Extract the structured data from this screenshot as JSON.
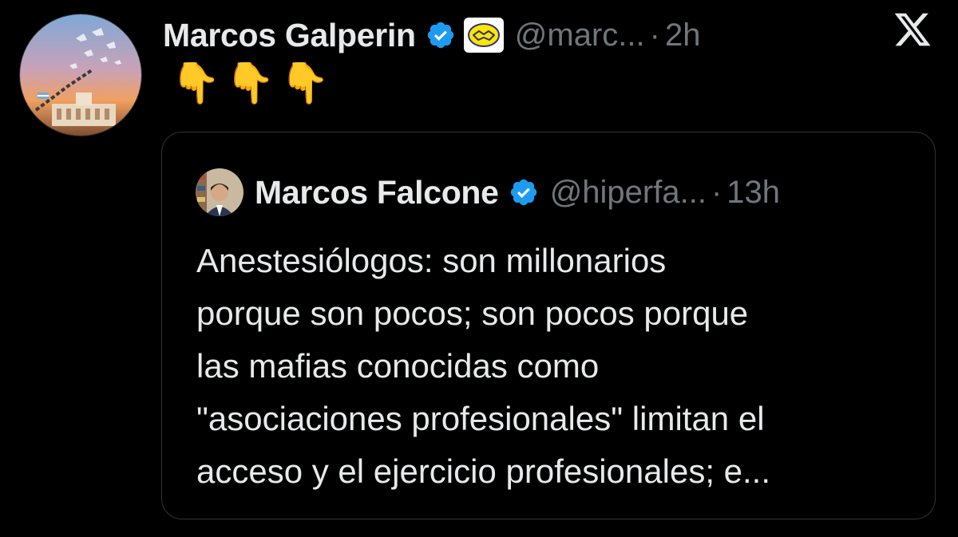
{
  "tweet": {
    "author": {
      "display_name": "Marcos Galperin",
      "handle": "@marc...",
      "time": "2h",
      "separator": "·",
      "verified_icon": "verified-badge-icon",
      "affiliate_icon": "handshake-affiliate-icon"
    },
    "text": "👇👇👇"
  },
  "quoted_tweet": {
    "author": {
      "display_name": "Marcos Falcone",
      "handle": "@hiperfa...",
      "time": "13h",
      "separator": "·",
      "verified_icon": "verified-badge-icon"
    },
    "text": "Anestesiólogos: son millonarios\nporque son pocos; son pocos porque\nlas mafias conocidas como\n\"asociaciones profesionales\" limitan el\nacceso y el ejercicio profesionales; e..."
  },
  "branding": {
    "logo_icon": "x-logo-icon"
  },
  "colors": {
    "background": "#000000",
    "text_primary": "#e7e9ea",
    "text_secondary": "#71767b",
    "verified_blue": "#1d9bf0",
    "card_border": "#2f3336"
  }
}
